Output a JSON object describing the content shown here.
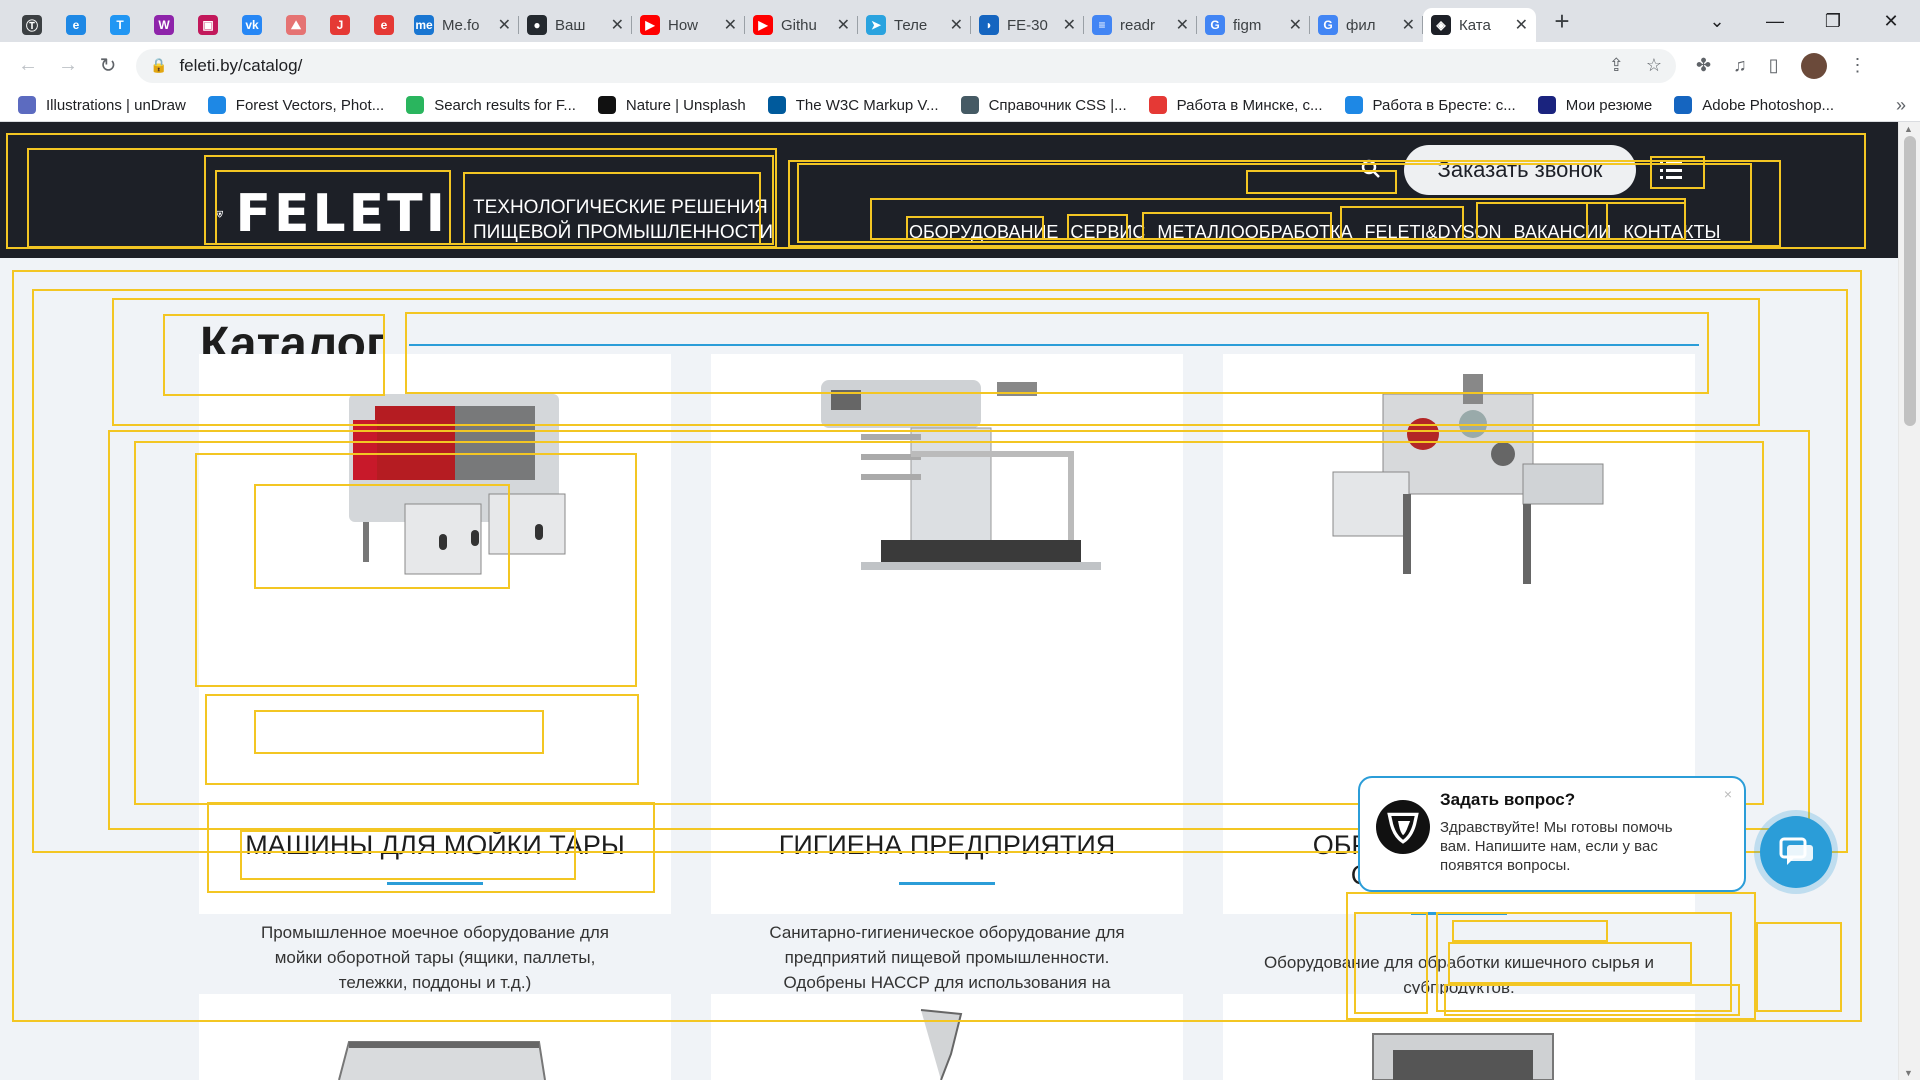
{
  "browser": {
    "tabs": [
      {
        "kind": "pinned",
        "icon": "tilda-icon",
        "color": "#3c4043",
        "glyph": "Ⓣ"
      },
      {
        "kind": "pinned",
        "icon": "e-icon",
        "color": "#1e88e5",
        "glyph": "e"
      },
      {
        "kind": "pinned",
        "icon": "t-icon",
        "color": "#2196f3",
        "glyph": "T"
      },
      {
        "kind": "pinned",
        "icon": "w-icon",
        "color": "#8e24aa",
        "glyph": "W"
      },
      {
        "kind": "pinned",
        "icon": "media-icon",
        "color": "#c2185b",
        "glyph": "▣"
      },
      {
        "kind": "pinned",
        "icon": "vk-icon",
        "color": "#2787f5",
        "glyph": "vk"
      },
      {
        "kind": "pinned",
        "icon": "pdf-icon",
        "color": "#e57373",
        "glyph": "⛰"
      },
      {
        "kind": "pinned",
        "icon": "j-icon",
        "color": "#e53935",
        "glyph": "J"
      },
      {
        "kind": "pinned",
        "icon": "e-red-icon",
        "color": "#e53935",
        "glyph": "e"
      },
      {
        "kind": "normal",
        "icon": "me-icon",
        "color": "#1976d2",
        "glyph": "me",
        "title": "Me.fo"
      },
      {
        "kind": "normal",
        "icon": "github-icon",
        "color": "#24292f",
        "glyph": "●",
        "title": "Ваш"
      },
      {
        "kind": "normal",
        "icon": "youtube-icon",
        "color": "#ff0000",
        "glyph": "▶",
        "title": "How"
      },
      {
        "kind": "normal",
        "icon": "youtube-icon",
        "color": "#ff0000",
        "glyph": "▶",
        "title": "Githu"
      },
      {
        "kind": "normal",
        "icon": "telegram-icon",
        "color": "#2aa3df",
        "glyph": "➤",
        "title": "Теле"
      },
      {
        "kind": "normal",
        "icon": "edge-icon",
        "color": "#1565c0",
        "glyph": "◗",
        "title": "FE-30"
      },
      {
        "kind": "normal",
        "icon": "doc-icon",
        "color": "#4285f4",
        "glyph": "≡",
        "title": "readr"
      },
      {
        "kind": "normal",
        "icon": "google-icon",
        "color": "#4285f4",
        "glyph": "G",
        "title": "figm"
      },
      {
        "kind": "normal",
        "icon": "google-icon",
        "color": "#4285f4",
        "glyph": "G",
        "title": "фил"
      },
      {
        "kind": "active",
        "icon": "feleti-icon",
        "color": "#1d2027",
        "glyph": "◈",
        "title": "Ката"
      }
    ],
    "new_tab": "+",
    "url": "feleti.by/catalog/",
    "bookmarks": [
      {
        "icon": "undraw-icon",
        "color": "#5c6bc0",
        "label": "Illustrations | unDraw"
      },
      {
        "icon": "freepik-icon",
        "color": "#1e88e5",
        "label": "Forest Vectors, Phot..."
      },
      {
        "icon": "vectorstock-icon",
        "color": "#2ab55e",
        "label": "Search results for F..."
      },
      {
        "icon": "unsplash-icon",
        "color": "#111111",
        "label": "Nature | Unsplash"
      },
      {
        "icon": "w3c-icon",
        "color": "#005a9c",
        "label": "The W3C Markup V..."
      },
      {
        "icon": "css-icon",
        "color": "#455a64",
        "label": "Справочник CSS |..."
      },
      {
        "icon": "rabota-icon",
        "color": "#e53935",
        "label": "Работа в Минске, с..."
      },
      {
        "icon": "search-job-icon",
        "color": "#1e88e5",
        "label": "Работа в Бресте: с..."
      },
      {
        "icon": "j-resume-icon",
        "color": "#1a237e",
        "label": "Мои резюме"
      },
      {
        "icon": "photoshop-icon",
        "color": "#1565c0",
        "label": "Adobe Photoshop..."
      }
    ],
    "bookmarks_more": "»"
  },
  "site": {
    "logo_text": "FELETI",
    "tagline": [
      "ТЕХНОЛОГИЧЕСКИЕ РЕШЕНИЯ",
      "ПИЩЕВОЙ ПРОМЫШЛЕННОСТИ"
    ],
    "callback_label": "Заказать звонок",
    "nav": [
      "ОБОРУДОВАНИЕ",
      "СЕРВИС",
      "МЕТАЛЛООБРАБОТКА",
      "FELETI&DYSON",
      "ВАКАНСИИ",
      "КОНТАКТЫ"
    ],
    "page_title": "Каталог",
    "accent": "#2b9dd8",
    "header_bg": "#1d2027",
    "debug_outline": "#f3c623"
  },
  "cards": [
    {
      "title": "МАШИНЫ ДЛЯ МОЙКИ ТАРЫ",
      "description": "Промышленное моечное оборудование для мойки оборотной тары (ящики, паллеты, тележки, поддоны и т.д.)"
    },
    {
      "title": "ГИГИЕНА ПРЕДПРИЯТИЯ",
      "description": "Санитарно-гигиеническое оборудование для предприятий пищевой промышленности. Одобрены НАССР для использования на пищевых производствах."
    },
    {
      "title": "ОБРАБОТКА КИШОК И СУБПРОДУКТОВ",
      "description": "Оборудование для обработки кишечного сырья и субпродуктов."
    }
  ],
  "chat": {
    "title": "Задать вопрос?",
    "text": "Здравствуйте! Мы готовы помочь вам. Напишите нам, если у вас появятся вопросы.",
    "close": "×"
  }
}
